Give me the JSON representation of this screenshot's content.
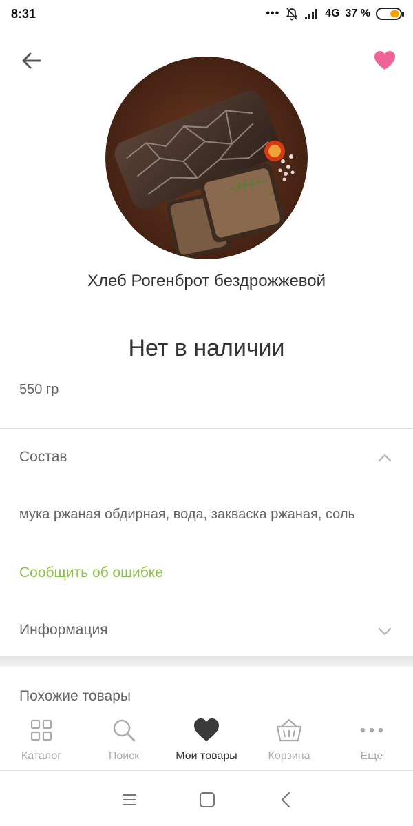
{
  "status_bar": {
    "time": "8:31",
    "dots": "•••",
    "network": "4G",
    "battery": "37 %",
    "battery_level": 0.37
  },
  "header": {
    "back_icon": "arrow-left-icon",
    "favorite_icon": "heart-icon",
    "favorite_color": "#f0649a"
  },
  "product": {
    "name": "Хлеб Рогенброт бездрожжевой",
    "availability": "Нет в наличии",
    "weight": "550 гр",
    "image": "product-photo-bread"
  },
  "sections": {
    "composition": {
      "title": "Состав",
      "text": "мука ржаная обдирная, вода, закваска ржаная, соль",
      "expanded": true
    },
    "report_error": "Сообщить об ошибке",
    "report_color": "#8bc34a",
    "info": {
      "title": "Информация",
      "expanded": false
    },
    "similar": {
      "title": "Похожие товары"
    }
  },
  "tabbar": {
    "active_index": 2,
    "items": [
      {
        "label": "Каталог",
        "icon": "grid-icon"
      },
      {
        "label": "Поиск",
        "icon": "search-icon"
      },
      {
        "label": "Мои товары",
        "icon": "heart-icon"
      },
      {
        "label": "Корзина",
        "icon": "basket-icon"
      },
      {
        "label": "Ещё",
        "icon": "more-icon"
      }
    ]
  },
  "navbar": {
    "items": [
      "menu-icon",
      "home-icon",
      "back-icon"
    ]
  }
}
